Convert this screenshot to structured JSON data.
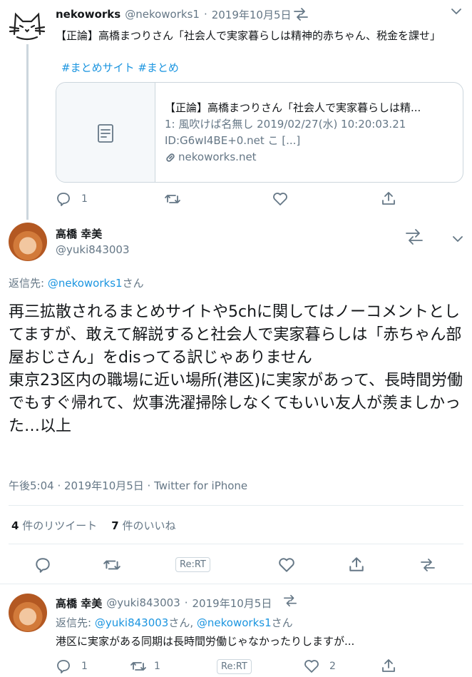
{
  "tweet1": {
    "display_name": "nekoworks",
    "handle": "@nekoworks1",
    "sep": "·",
    "date": "2019年10月5日",
    "text": "【正論】高橋まつりさん「社会人で実家暮らしは精神的赤ちゃん、税金を課せ」",
    "hashtags": "#まとめサイト #まとめ",
    "card": {
      "title": "【正論】高橋まつりさん「社会人で実家暮らしは精...",
      "line1": "1: 風吹けば名無し 2019/02/27(水) 10:20:03.21",
      "line2": "ID:G6wI4BE+0.net こ [...]",
      "domain": "nekoworks.net"
    },
    "reply_count": "1"
  },
  "tweet2": {
    "display_name": "高橋 幸美",
    "handle": "@yuki843003",
    "reply_to_label": "返信先:",
    "reply_to_handle": "@nekoworks1",
    "reply_to_suffix": "さん",
    "text": "再三拡散されるまとめサイトや5chに関してはノーコメントとしてますが、敢えて解説すると社会人で実家暮らしは「赤ちゃん部屋おじさん」をdisってる訳じゃありません\n東京23区内の職場に近い場所(港区)に実家があって、長時間労働でもすぐ帰れて、炊事洗濯掃除しなくてもいい友人が羨ましかった…以上",
    "meta": "午後5:04 · 2019年10月5日 · Twitter for iPhone",
    "retweet_count": "4",
    "retweet_label": "件のリツイート",
    "like_count": "7",
    "like_label": "件のいいね",
    "rert_label": "Re:RT"
  },
  "tweet3": {
    "display_name": "高橋 幸美",
    "handle": "@yuki843003",
    "sep": "·",
    "date": "2019年10月5日",
    "reply_to_label": "返信先:",
    "reply_to_handle1": "@yuki843003",
    "reply_to_mid": "さん, ",
    "reply_to_handle2": "@nekoworks1",
    "reply_to_suffix": "さん",
    "text": "港区に実家がある同期は長時間労働じゃなかったりしますが...",
    "reply_count": "1",
    "retweet_count": "1",
    "like_count": "2",
    "rert_label": "Re:RT"
  },
  "colors": {
    "link": "#1b95e0",
    "muted": "#657786",
    "border": "#ccd6dd"
  },
  "icons": [
    "cat-logo-icon",
    "retweet-arrows-icon",
    "chevron-down-icon",
    "document-icon",
    "link-icon",
    "reply-icon",
    "retweet-icon",
    "like-icon",
    "share-icon"
  ]
}
